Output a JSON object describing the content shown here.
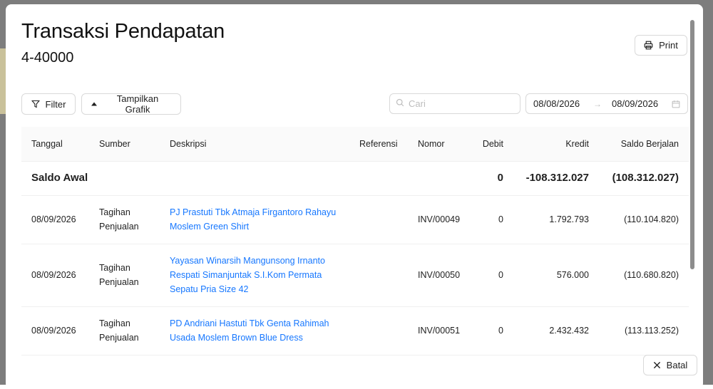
{
  "modal": {
    "title": "Transaksi Pendapatan",
    "subtitle": "4-40000",
    "print_label": "Print",
    "cancel_label": "Batal"
  },
  "toolbar": {
    "filter_label": "Filter",
    "chart_label": "Tampilkan Grafik",
    "search_placeholder": "Cari",
    "search_value": "",
    "date_from": "08/08/2026",
    "date_to": "08/09/2026"
  },
  "table": {
    "columns": [
      "Tanggal",
      "Sumber",
      "Deskripsi",
      "Referensi",
      "Nomor",
      "Debit",
      "Kredit",
      "Saldo Berjalan"
    ],
    "opening": {
      "label": "Saldo Awal",
      "debit": "0",
      "kredit": "-108.312.027",
      "saldo": "(108.312.027)"
    },
    "rows": [
      {
        "tanggal": "08/09/2026",
        "sumber_1": "Tagihan",
        "sumber_2": "Penjualan",
        "desc_1": "PJ Prastuti Tbk Atmaja Firgantoro Rahayu",
        "desc_2": "Moslem Green Shirt",
        "desc_3": "",
        "referensi": "",
        "nomor": "INV/00049",
        "debit": "0",
        "kredit": "1.792.793",
        "saldo": "(110.104.820)"
      },
      {
        "tanggal": "08/09/2026",
        "sumber_1": "Tagihan",
        "sumber_2": "Penjualan",
        "desc_1": "Yayasan Winarsih Mangunsong Irnanto",
        "desc_2": "Respati Simanjuntak S.I.Kom Permata",
        "desc_3": "Sepatu Pria Size 42",
        "referensi": "",
        "nomor": "INV/00050",
        "debit": "0",
        "kredit": "576.000",
        "saldo": "(110.680.820)"
      },
      {
        "tanggal": "08/09/2026",
        "sumber_1": "Tagihan",
        "sumber_2": "Penjualan",
        "desc_1": "PD Andriani Hastuti Tbk Genta Rahimah",
        "desc_2": "Usada Moslem Brown Blue Dress",
        "desc_3": "",
        "referensi": "",
        "nomor": "INV/00051",
        "debit": "0",
        "kredit": "2.432.432",
        "saldo": "(113.113.252)"
      }
    ]
  }
}
